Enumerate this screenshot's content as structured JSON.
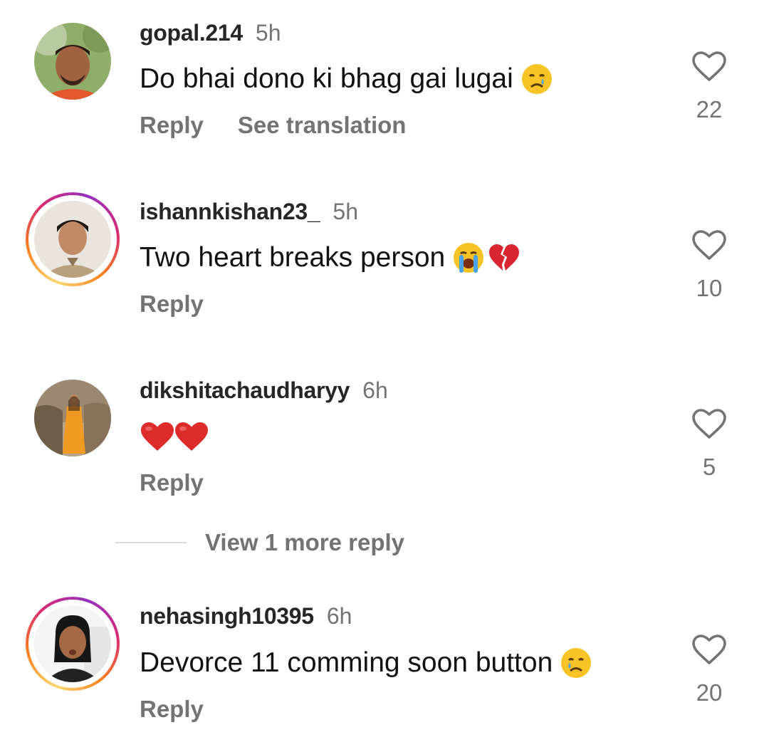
{
  "comments": [
    {
      "username": "gopal.214",
      "time": "5h",
      "text": "Do bhai dono ki bhag gai lugai",
      "emojis": [
        "crying-face"
      ],
      "reply_label": "Reply",
      "translation_label": "See translation",
      "likes": "22",
      "has_story_ring": false
    },
    {
      "username": "ishannkishan23_",
      "time": "5h",
      "text": "Two heart breaks person",
      "emojis": [
        "loudly-crying-face",
        "broken-heart"
      ],
      "reply_label": "Reply",
      "likes": "10",
      "has_story_ring": true
    },
    {
      "username": "dikshitachaudharyy",
      "time": "6h",
      "text": "",
      "emojis": [
        "red-heart",
        "red-heart"
      ],
      "reply_label": "Reply",
      "likes": "5",
      "has_story_ring": false,
      "view_more_label": "View 1 more reply"
    },
    {
      "username": "nehasingh10395",
      "time": "6h",
      "text": "Devorce 11 comming soon button",
      "emojis": [
        "crying-face"
      ],
      "reply_label": "Reply",
      "likes": "20",
      "has_story_ring": true
    }
  ],
  "colors": {
    "text": "#111111",
    "username": "#262626",
    "muted": "#737373",
    "divider": "#dbdbdb",
    "story_ring_start": "#feda75",
    "story_ring_end": "#d62976"
  }
}
